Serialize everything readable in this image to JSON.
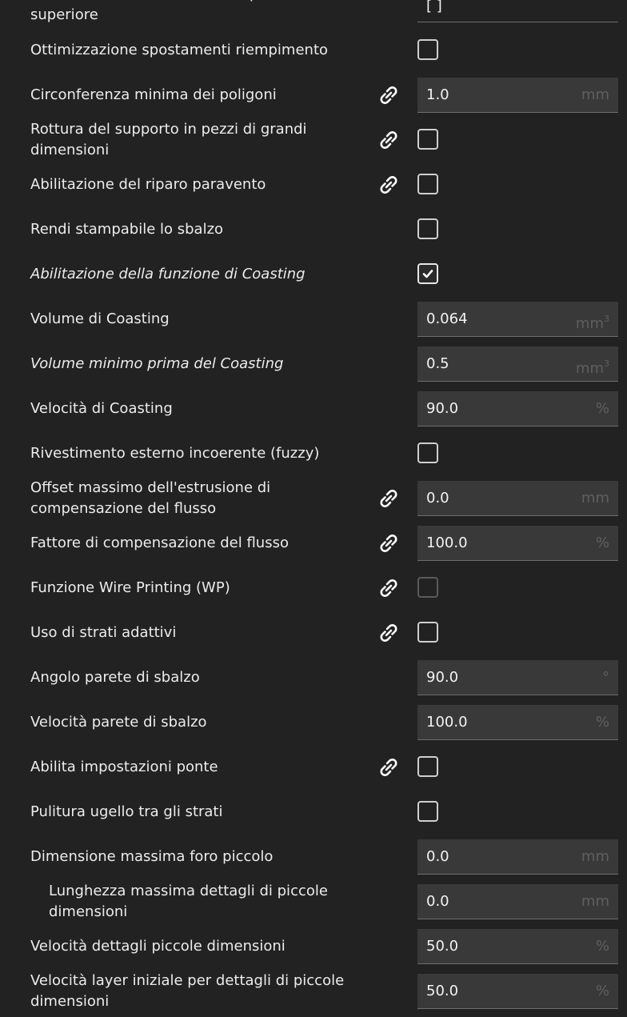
{
  "settings": {
    "r0": {
      "label": "Direzioni linea rivestimento superficie superiore",
      "value": "[ ]"
    },
    "r1": {
      "label": "Ottimizzazione spostamenti riempimento",
      "checked": false
    },
    "r2": {
      "label": "Circonferenza minima dei poligoni",
      "value": "1.0",
      "unit": "mm",
      "linked": true
    },
    "r3": {
      "label": "Rottura del supporto in pezzi di grandi dimensioni",
      "checked": false,
      "linked": true
    },
    "r4": {
      "label": "Abilitazione del riparo paravento",
      "checked": false,
      "linked": true
    },
    "r5": {
      "label": "Rendi stampabile lo sbalzo",
      "checked": false
    },
    "r6": {
      "label": "Abilitazione della funzione di Coasting",
      "checked": true,
      "italic": true
    },
    "r7": {
      "label": "Volume di Coasting",
      "value": "0.064",
      "unit": "mm",
      "unit_sup": "3"
    },
    "r8": {
      "label": "Volume minimo prima del Coasting",
      "value": "0.5",
      "unit": "mm",
      "unit_sup": "3",
      "italic": true
    },
    "r9": {
      "label": "Velocità di Coasting",
      "value": "90.0",
      "unit": "%"
    },
    "r10": {
      "label": "Rivestimento esterno incoerente (fuzzy)",
      "checked": false
    },
    "r11": {
      "label": "Offset massimo dell'estrusione di compensazione del flusso",
      "value": "0.0",
      "unit": "mm",
      "linked": true
    },
    "r12": {
      "label": "Fattore di compensazione del flusso",
      "value": "100.0",
      "unit": "%",
      "linked": true
    },
    "r13": {
      "label": "Funzione Wire Printing (WP)",
      "checked": false,
      "linked": true,
      "disabled": true
    },
    "r14": {
      "label": "Uso di strati adattivi",
      "checked": false,
      "linked": true
    },
    "r15": {
      "label": "Angolo parete di sbalzo",
      "value": "90.0",
      "unit": "°"
    },
    "r16": {
      "label": "Velocità parete di sbalzo",
      "value": "100.0",
      "unit": "%"
    },
    "r17": {
      "label": "Abilita impostazioni ponte",
      "checked": false,
      "linked": true
    },
    "r18": {
      "label": "Pulitura ugello tra gli strati",
      "checked": false
    },
    "r19": {
      "label": "Dimensione massima foro piccolo",
      "value": "0.0",
      "unit": "mm"
    },
    "r20": {
      "label": "Lunghezza massima dettagli di piccole dimensioni",
      "value": "0.0",
      "unit": "mm",
      "indent": true
    },
    "r21": {
      "label": "Velocità dettagli piccole dimensioni",
      "value": "50.0",
      "unit": "%"
    },
    "r22": {
      "label": "Velocità layer iniziale per dettagli di piccole dimensioni",
      "value": "50.0",
      "unit": "%"
    }
  },
  "icons": {
    "link": "link-icon",
    "check": "checkmark-icon"
  },
  "colors": {
    "background": "#222222",
    "field": "#393939",
    "unit": "#5f5f5f",
    "text": "#ececec"
  }
}
